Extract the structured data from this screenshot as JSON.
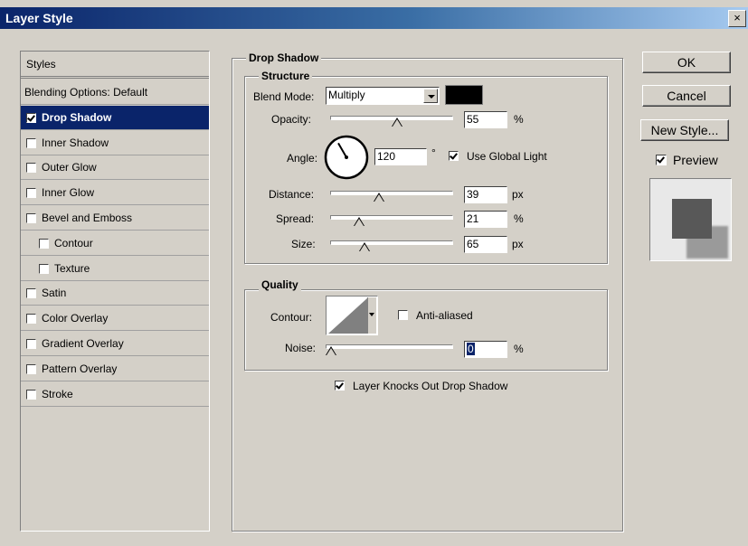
{
  "window": {
    "title": "Layer Style",
    "close_glyph": "×"
  },
  "styles_panel": {
    "header": "Styles",
    "items": [
      {
        "label": "Blending Options: Default",
        "checkbox": false,
        "checked": false,
        "selected": false,
        "indent": 0
      },
      {
        "label": "Drop Shadow",
        "checkbox": true,
        "checked": true,
        "selected": true,
        "indent": 0
      },
      {
        "label": "Inner Shadow",
        "checkbox": true,
        "checked": false,
        "selected": false,
        "indent": 0
      },
      {
        "label": "Outer Glow",
        "checkbox": true,
        "checked": false,
        "selected": false,
        "indent": 0
      },
      {
        "label": "Inner Glow",
        "checkbox": true,
        "checked": false,
        "selected": false,
        "indent": 0
      },
      {
        "label": "Bevel and Emboss",
        "checkbox": true,
        "checked": false,
        "selected": false,
        "indent": 0
      },
      {
        "label": "Contour",
        "checkbox": true,
        "checked": false,
        "selected": false,
        "indent": 1
      },
      {
        "label": "Texture",
        "checkbox": true,
        "checked": false,
        "selected": false,
        "indent": 1
      },
      {
        "label": "Satin",
        "checkbox": true,
        "checked": false,
        "selected": false,
        "indent": 0
      },
      {
        "label": "Color Overlay",
        "checkbox": true,
        "checked": false,
        "selected": false,
        "indent": 0
      },
      {
        "label": "Gradient Overlay",
        "checkbox": true,
        "checked": false,
        "selected": false,
        "indent": 0
      },
      {
        "label": "Pattern Overlay",
        "checkbox": true,
        "checked": false,
        "selected": false,
        "indent": 0
      },
      {
        "label": "Stroke",
        "checkbox": true,
        "checked": false,
        "selected": false,
        "indent": 0
      }
    ]
  },
  "drop_shadow": {
    "section_title": "Drop Shadow",
    "structure_title": "Structure",
    "blend_mode_label": "Blend Mode:",
    "blend_mode_value": "Multiply",
    "shadow_color": "#000000",
    "opacity_label": "Opacity:",
    "opacity_value": "55",
    "opacity_unit": "%",
    "opacity_fraction": 0.55,
    "angle_label": "Angle:",
    "angle_value": "120",
    "angle_unit": "°",
    "angle_degrees": 120,
    "use_global_light_label": "Use Global Light",
    "use_global_light": true,
    "distance_label": "Distance:",
    "distance_value": "39",
    "distance_unit": "px",
    "distance_fraction": 0.39,
    "spread_label": "Spread:",
    "spread_value": "21",
    "spread_unit": "%",
    "spread_fraction": 0.21,
    "size_label": "Size:",
    "size_value": "65",
    "size_unit": "px",
    "size_fraction": 0.26
  },
  "quality": {
    "title": "Quality",
    "contour_label": "Contour:",
    "anti_aliased_label": "Anti-aliased",
    "anti_aliased": false,
    "noise_label": "Noise:",
    "noise_value": "0",
    "noise_unit": "%",
    "noise_fraction": 0
  },
  "layer_knocks_out_label": "Layer Knocks Out Drop Shadow",
  "layer_knocks_out": true,
  "buttons": {
    "ok": "OK",
    "cancel": "Cancel",
    "new_style": "New Style..."
  },
  "preview": {
    "label": "Preview",
    "checked": true
  },
  "colors": {
    "selection": "#0a246a",
    "dialog_bg": "#d4d0c8"
  }
}
